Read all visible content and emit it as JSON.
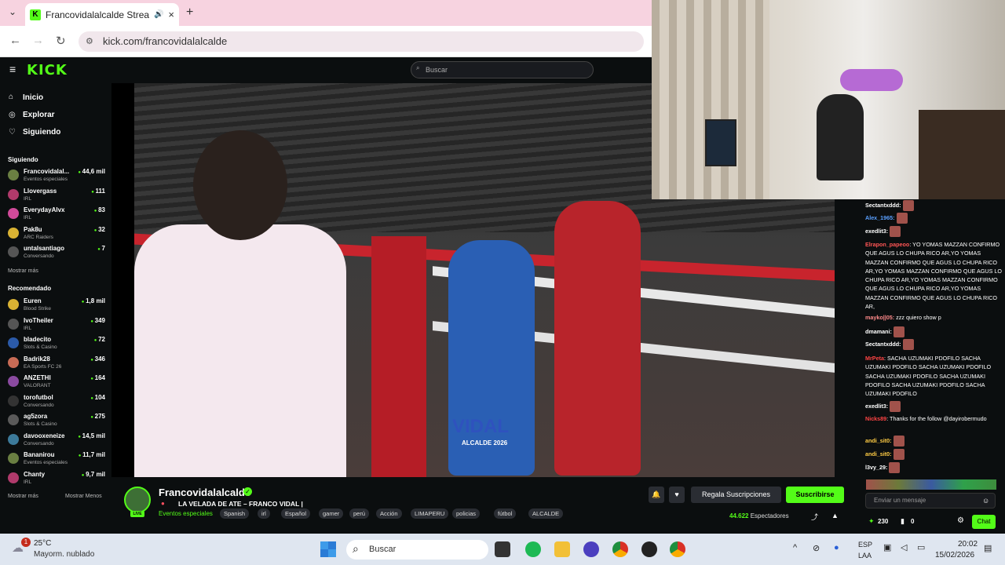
{
  "browser": {
    "tab_title": "Francovidalalcalde Stream -",
    "new_tab": "+",
    "url": "kick.com/francovidalalcalde"
  },
  "kick": {
    "logo": "KICK",
    "search_placeholder": "Buscar",
    "nav": [
      "Inicio",
      "Explorar",
      "Siguiendo"
    ],
    "following_header": "Siguiendo",
    "following": [
      {
        "name": "Francovidalal...",
        "category": "Eventos especiales",
        "viewers": "44,6 mil"
      },
      {
        "name": "Llovergass",
        "category": "IRL",
        "viewers": "111"
      },
      {
        "name": "EverydayAlvx",
        "category": "IRL",
        "viewers": "83"
      },
      {
        "name": "Pak8u",
        "category": "ARC Raiders",
        "viewers": "32"
      },
      {
        "name": "untalsantiago",
        "category": "Conversando",
        "viewers": "7"
      }
    ],
    "show_more": "Mostrar más",
    "recommended_header": "Recomendado",
    "recommended": [
      {
        "name": "Euren",
        "category": "Blood Strike",
        "viewers": "1,8 mil"
      },
      {
        "name": "IvoTheiler",
        "category": "IRL",
        "viewers": "349"
      },
      {
        "name": "bladecito",
        "category": "Slots & Casino",
        "viewers": "72"
      },
      {
        "name": "Badrik28",
        "category": "EA Sports FC 26",
        "viewers": "346"
      },
      {
        "name": "ANZETHI",
        "category": "VALORANT",
        "viewers": "164"
      },
      {
        "name": "torofutbol",
        "category": "Conversando",
        "viewers": "104"
      },
      {
        "name": "ag5zora",
        "category": "Slots & Casino",
        "viewers": "275"
      },
      {
        "name": "davooxeneize",
        "category": "Conversando",
        "viewers": "14,5 mil"
      },
      {
        "name": "Bananirou",
        "category": "Eventos especiales",
        "viewers": "11,7 mil"
      },
      {
        "name": "Chanty",
        "category": "IRL",
        "viewers": "9,7 mil"
      }
    ],
    "show_more_2": "Mostrar más",
    "show_less": "Mostrar Menos"
  },
  "stream": {
    "name": "Francovidalalcalde",
    "title": "LA VELADA DE ATE – FRANCO VIDAL |",
    "category": "Eventos especiales",
    "tags": [
      "Spanish",
      "irl",
      "Español",
      "gamer",
      "perú",
      "Acción",
      "LIMAPERU",
      "policias",
      "fútbol",
      "ALCALDE"
    ],
    "live": "LIVE",
    "gift_subs": "Regala Suscripciones",
    "subscribe": "Suscribirse",
    "viewers_count": "44.622",
    "viewers_label": "Espectadores",
    "overlay_name": "VIDAL",
    "overlay_sub": "ALCALDE 2026"
  },
  "chat": {
    "messages": [
      {
        "user": "Sectantxddd:",
        "color": "#ffffff",
        "text": ""
      },
      {
        "user": "Alex_1965:",
        "color": "#5aa0ff",
        "text": ""
      },
      {
        "user": "exedlit3:",
        "color": "#ffffff",
        "text": ""
      },
      {
        "user": "Elrapon_papeoo",
        "color": "#ff5555",
        "text": ": YO YOMAS MAZZAN CONFIRMO QUE AGUS LO CHUPA RICO AR,YO YOMAS MAZZAN CONFIRMO QUE AGUS LO CHUPA RICO AR,YO YOMAS MAZZAN CONFIRMO QUE AGUS LO CHUPA RICO AR,YO YOMAS MAZZAN CONFIRMO QUE AGUS LO CHUPA RICO AR,YO YOMAS MAZZAN CONFIRMO QUE AGUS LO CHUPA RICO AR,"
      },
      {
        "user": "mayko||05:",
        "color": "#ff8a8a",
        "text": " zzz quiero show p"
      },
      {
        "user": "dmamani:",
        "color": "#ffffff",
        "text": ""
      },
      {
        "user": "Sectantxddd:",
        "color": "#ffffff",
        "text": ""
      },
      {
        "user": "MrPeta",
        "color": "#ff4444",
        "text": ": SACHA UZUMAKI PDOFILO SACHA UZUMAKI PDOFILO SACHA UZUMAKI PDOFILO SACHA UZUMAKI PDOFILO SACHA UZUMAKI PDOFILO SACHA UZUMAKI PDOFILO SACHA UZUMAKI PDOFILO"
      },
      {
        "user": "exedlit3:",
        "color": "#ffffff",
        "text": ""
      },
      {
        "user": "Nicks89",
        "color": "#ff4444",
        "text": ": Thanks for the follow @dayirobermudo"
      },
      {
        "user": "andi_sit0:",
        "color": "#ffcc44",
        "text": ""
      },
      {
        "user": "andi_sit0:",
        "color": "#ffcc44",
        "text": ""
      },
      {
        "user": "l3vy_29:",
        "color": "#ffffff",
        "text": ""
      }
    ],
    "input_placeholder": "Enviar un mensaje",
    "points": "230",
    "count": "0",
    "send": "Chat"
  },
  "taskbar": {
    "weather_temp": "25°C",
    "weather_desc": "Mayorm. nublado",
    "weather_badge": "1",
    "search": "Buscar",
    "lang1": "ESP",
    "lang2": "LAA",
    "time": "20:02",
    "date": "15/02/2026"
  }
}
